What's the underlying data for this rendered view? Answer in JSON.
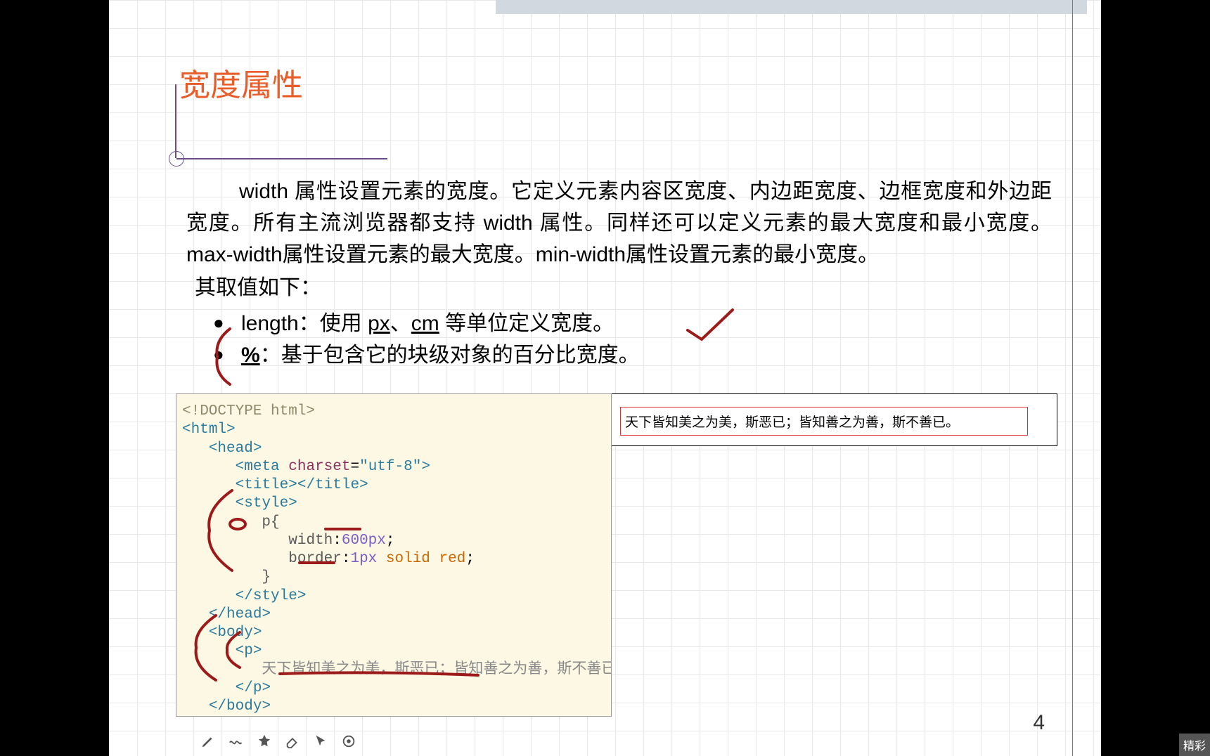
{
  "slide": {
    "title": "宽度属性",
    "body_text": "width 属性设置元素的宽度。它定义元素内容区宽度、内边距宽度、边框宽度和外边距宽度。所有主流浏览器都支持 width 属性。同样还可以定义元素的最大宽度和最小宽度。max-width属性设置元素的最大宽度。min-width属性设置元素的最小宽度。",
    "values_label": "其取值如下：",
    "bullets": [
      {
        "key": "length",
        "sep": "：",
        "desc_pre": "使用 ",
        "u1": "px",
        "mid": "、",
        "u2": "cm",
        "desc_post": " 等单位定义宽度。"
      },
      {
        "key": "%",
        "sep": "：",
        "desc": "基于包含它的块级对象的百分比宽度。"
      }
    ],
    "page_number": "4"
  },
  "code": {
    "doctype": "<!DOCTYPE html>",
    "html_open": "<",
    "html_tag": "html",
    "close": ">",
    "head_open": "<",
    "head_tag": "head",
    "meta": "meta",
    "charset_attr": "charset",
    "charset_val": "\"utf-8\"",
    "title_tag": "title",
    "style_tag": "style",
    "selector": "p{",
    "width_prop": "width",
    "colon": ":",
    "width_val": "600px",
    "semi": ";",
    "border_prop": "border",
    "border_len": "1px",
    "border_solid": "solid",
    "border_color": "red",
    "brace_close": "}",
    "body_tag": "body",
    "p_tag": "p",
    "p_text": "天下皆知美之为美，斯恶已；皆知善之为善，斯不善已。",
    "slash": "/"
  },
  "output": {
    "text": "天下皆知美之为美，斯恶已；皆知善之为善，斯不善已。"
  },
  "tools": {
    "pen": "pen-icon",
    "wave": "wave-icon",
    "stamp": "stamp-icon",
    "eraser": "eraser-icon",
    "pointer": "pointer-icon",
    "record": "record-icon"
  },
  "footer": {
    "label": "精彩"
  }
}
